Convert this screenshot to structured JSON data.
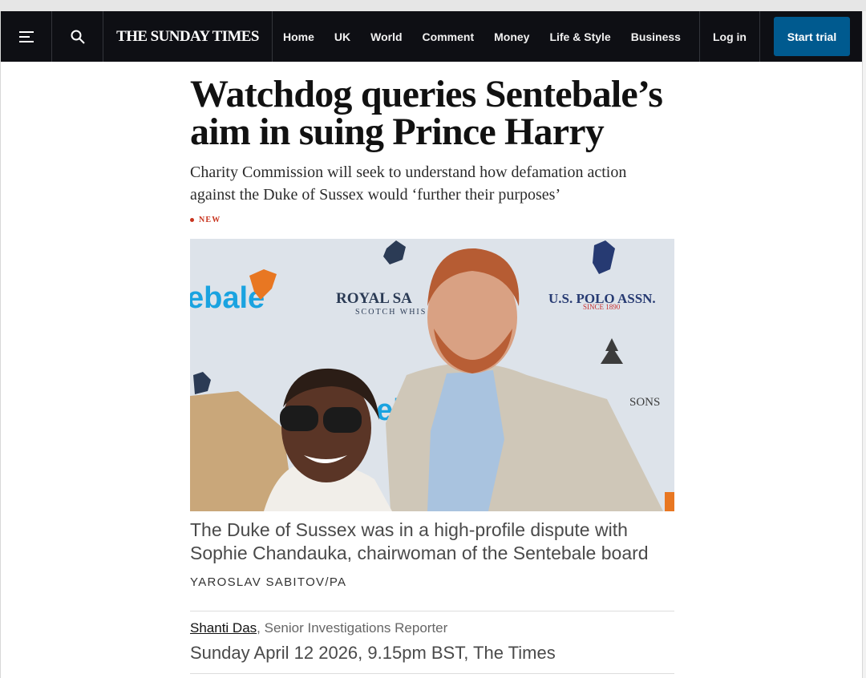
{
  "nav": {
    "logo": "THE SUNDAY TIMES",
    "links": [
      "Home",
      "UK",
      "World",
      "Comment",
      "Money",
      "Life & Style",
      "Business"
    ],
    "login": "Log in",
    "trial": "Start trial",
    "icons": {
      "menu": "hamburger-icon",
      "search": "search-icon"
    }
  },
  "article": {
    "headline": "Watchdog queries Sentebale’s aim in suing Prince Harry",
    "standfirst": "Charity Commission will seek to understand how defamation action against the Duke of Sussex would ‘further their purposes’",
    "flag": "NEW",
    "photo": {
      "sponsor_1": "ebale",
      "sponsor_2": "ROYAL SA",
      "sponsor_2_sub": "SCOTCH WHIS",
      "sponsor_3": "U.S. POLO ASSN.",
      "sponsor_3_sub": "SINCE 1890",
      "sponsor_4": "ebal",
      "sponsor_5": "SONS"
    },
    "caption": "The Duke of Sussex was in a high-profile dispute with Sophie Chandauka, chairwoman of the Sentebale board",
    "credit": "YAROSLAV SABITOV/PA",
    "author": "Shanti Das",
    "author_role": ", Senior Investigations Reporter",
    "dateline": "Sunday April 12 2026, 9.15pm BST, The Times"
  },
  "colors": {
    "nav_bg": "#0e0f14",
    "trial_btn": "#005a8f",
    "flag": "#c8341e"
  }
}
